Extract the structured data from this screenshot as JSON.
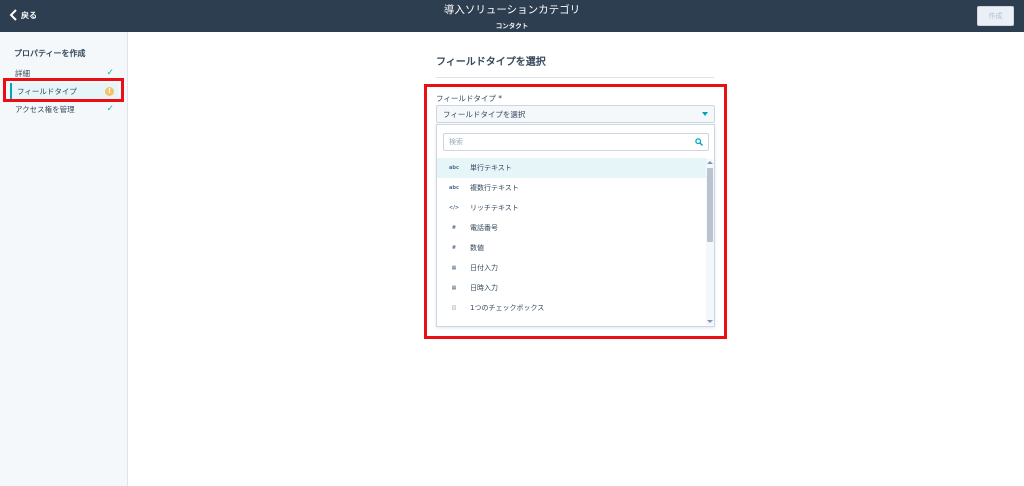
{
  "header": {
    "back_label": "戻る",
    "title": "導入ソリューションカテゴリ",
    "subtitle": "コンタクト",
    "create_label": "作成"
  },
  "sidebar": {
    "title": "プロパティーを作成",
    "steps": [
      {
        "label": "詳細",
        "status": "complete"
      },
      {
        "label": "フィールドタイプ",
        "status": "warning",
        "warning_glyph": "!"
      },
      {
        "label": "アクセス権を管理",
        "status": "complete"
      }
    ]
  },
  "main": {
    "title": "フィールドタイプを選択",
    "field_label": "フィールドタイプ *",
    "select_value": "フィールドタイプを選択",
    "search_placeholder": "検索",
    "options": [
      {
        "icon": "abc",
        "label": "単行テキスト"
      },
      {
        "icon": "abc",
        "label": "複数行テキスト"
      },
      {
        "icon": "</>",
        "label": "リッチテキスト"
      },
      {
        "icon": "#",
        "label": "電話番号"
      },
      {
        "icon": "#",
        "label": "数値"
      },
      {
        "icon": "▦",
        "label": "日付入力"
      },
      {
        "icon": "▦",
        "label": "日時入力"
      },
      {
        "icon": "◫",
        "label": "1つのチェックボックス"
      }
    ]
  },
  "colors": {
    "header_bg": "#2d3e50",
    "accent": "#00a4bd",
    "check": "#00bda5",
    "warning": "#f5c26b",
    "highlight_box": "#ea0f14"
  }
}
